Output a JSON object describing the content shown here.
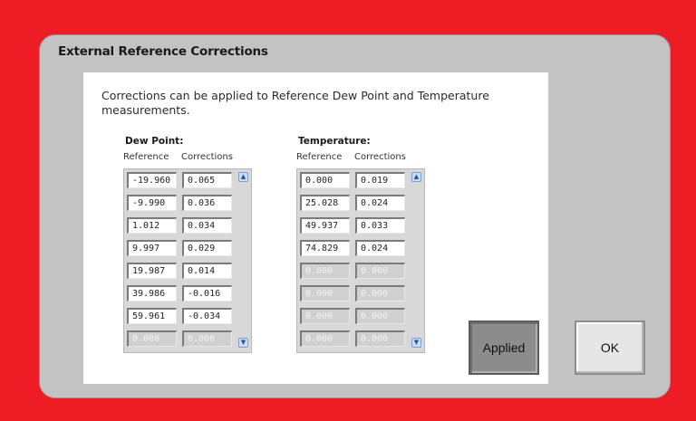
{
  "dialog": {
    "title": "External Reference Corrections",
    "description": "Corrections can be applied to Reference Dew Point and Temperature measurements."
  },
  "dew_point": {
    "title": "Dew Point:",
    "ref_header": "Reference",
    "corr_header": "Corrections",
    "rows": [
      {
        "reference": "-19.960",
        "correction": "0.065",
        "enabled": true
      },
      {
        "reference": "-9.990",
        "correction": "0.036",
        "enabled": true
      },
      {
        "reference": "1.012",
        "correction": "0.034",
        "enabled": true
      },
      {
        "reference": "9.997",
        "correction": "0.029",
        "enabled": true
      },
      {
        "reference": "19.987",
        "correction": "0.014",
        "enabled": true
      },
      {
        "reference": "39.986",
        "correction": "-0.016",
        "enabled": true
      },
      {
        "reference": "59.961",
        "correction": "-0.034",
        "enabled": true
      },
      {
        "reference": "0.000",
        "correction": "0.000",
        "enabled": false
      }
    ]
  },
  "temperature": {
    "title": "Temperature:",
    "ref_header": "Reference",
    "corr_header": "Corrections",
    "rows": [
      {
        "reference": "0.000",
        "correction": "0.019",
        "enabled": true
      },
      {
        "reference": "25.028",
        "correction": "0.024",
        "enabled": true
      },
      {
        "reference": "49.937",
        "correction": "0.033",
        "enabled": true
      },
      {
        "reference": "74.829",
        "correction": "0.024",
        "enabled": true
      },
      {
        "reference": "0.000",
        "correction": "0.000",
        "enabled": false
      },
      {
        "reference": "0.000",
        "correction": "0.000",
        "enabled": false
      },
      {
        "reference": "0.000",
        "correction": "0.000",
        "enabled": false
      },
      {
        "reference": "0.000",
        "correction": "0.000",
        "enabled": false
      }
    ]
  },
  "buttons": {
    "applied_label": "Applied",
    "ok_label": "OK"
  },
  "icons": {
    "scroll_up": "scroll-up-icon",
    "scroll_down": "scroll-down-icon"
  },
  "colors": {
    "background": "#ee1c24",
    "dialog": "#c3c3c3",
    "applied_button": "#8c8c8c"
  }
}
